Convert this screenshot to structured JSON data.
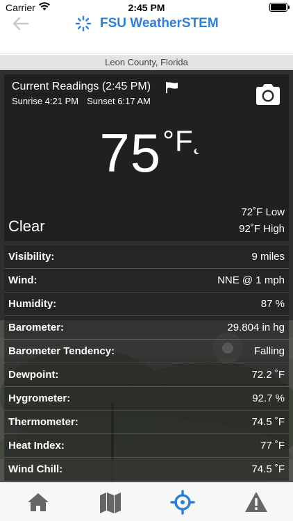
{
  "statusbar": {
    "carrier": "Carrier",
    "time": "2:45 PM"
  },
  "nav": {
    "title": "FSU WeatherSTEM"
  },
  "location": "Leon County, Florida",
  "current": {
    "heading": "Current Readings (2:45 PM)",
    "sunrise": "Sunrise 4:21 PM",
    "sunset": "Sunset 6:17 AM",
    "temperature": "75",
    "unit": "°F",
    "condition": "Clear",
    "low": "72˚F Low",
    "high": "92˚F High"
  },
  "readings": [
    {
      "label": "Visibility:",
      "value": "9 miles"
    },
    {
      "label": "Wind:",
      "value": "NNE @ 1 mph"
    },
    {
      "label": "Humidity:",
      "value": "87 %"
    },
    {
      "label": "Barometer:",
      "value": "29.804 in hg"
    },
    {
      "label": "Barometer Tendency:",
      "value": "Falling"
    },
    {
      "label": "Dewpoint:",
      "value": "72.2 ˚F"
    },
    {
      "label": "Hygrometer:",
      "value": "92.7 %"
    },
    {
      "label": "Thermometer:",
      "value": "74.5 ˚F"
    },
    {
      "label": "Heat Index:",
      "value": "77 ˚F"
    },
    {
      "label": "Wind Chill:",
      "value": "74.5 ˚F"
    }
  ],
  "tabs": [
    {
      "icon": "home-icon"
    },
    {
      "icon": "map-icon"
    },
    {
      "icon": "crosshair-icon",
      "color": "#2e7fd6"
    },
    {
      "icon": "warning-icon"
    }
  ],
  "colors": {
    "accent": "#2e7fd6",
    "inactive_tab": "#666666"
  }
}
